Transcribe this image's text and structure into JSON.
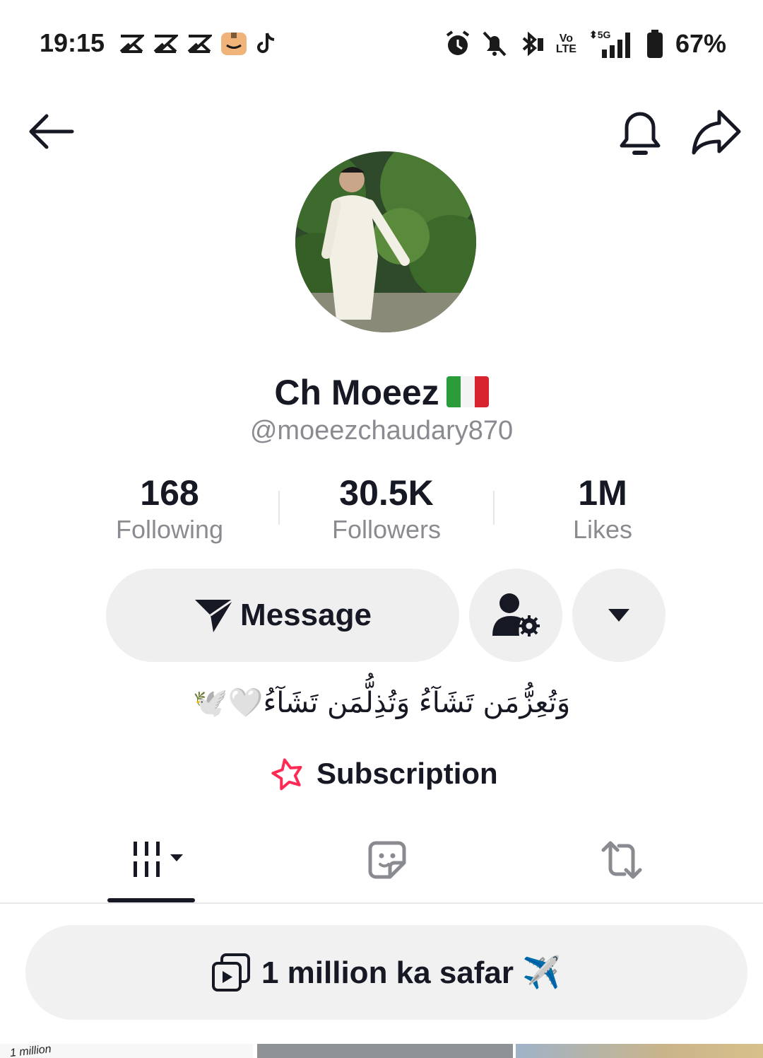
{
  "status_bar": {
    "time": "19:15",
    "battery": "67%",
    "volte_line1": "Vo",
    "volte_line2": "LTE",
    "network": "5G",
    "icons_left": [
      "capcut-icon",
      "capcut-icon",
      "capcut-icon",
      "amazon-icon",
      "tiktok-icon"
    ],
    "icons_right": [
      "alarm-icon",
      "mute-icon",
      "bluetooth-icon",
      "volte-icon",
      "signal-icon",
      "battery-icon"
    ]
  },
  "header": {
    "icons": [
      "back-arrow-icon",
      "bell-icon",
      "share-icon"
    ]
  },
  "profile": {
    "display_name": "Ch Moeez",
    "flag": "italy-flag",
    "username": "@moeezchaudary870",
    "bio": "وَتُعِزُّمَن تَشَآءُ وَتُذِلُّمَن تَشَآءُ🤍🕊️",
    "subscription_label": "Subscription"
  },
  "stats": [
    {
      "value": "168",
      "label": "Following"
    },
    {
      "value": "30.5K",
      "label": "Followers"
    },
    {
      "value": "1M",
      "label": "Likes"
    }
  ],
  "actions": {
    "message_label": "Message",
    "follow_settings_icon": "user-settings-icon",
    "more_icon": "caret-down-icon"
  },
  "tabs": [
    {
      "name": "videos",
      "icon": "grid-icon",
      "active": true
    },
    {
      "name": "private",
      "icon": "sticker-icon",
      "active": false
    },
    {
      "name": "reposts",
      "icon": "repost-icon",
      "active": false
    }
  ],
  "playlist": {
    "label": "1 million ka safar ✈️"
  },
  "thumbnails": {
    "first_caption": "1 million"
  },
  "colors": {
    "text": "#161823",
    "secondary_text": "#8a8b91",
    "button_bg": "#efefef",
    "subscription_accent": "#fe2c55"
  }
}
